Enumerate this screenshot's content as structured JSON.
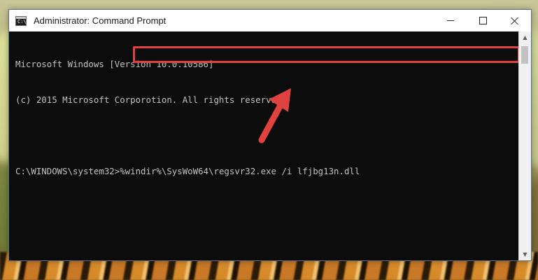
{
  "window": {
    "title": "Administrator: Command Prompt",
    "icon_label": "C:\\_"
  },
  "controls": {
    "minimize": "minimize",
    "maximize": "maximize",
    "close": "close"
  },
  "console": {
    "lines": [
      "Microsoft Windows [Version 10.0.10586]",
      "(c) 2015 Microsoft Corporotion. All rights reserved."
    ],
    "prompt": "C:\\WINDOWS\\system32>",
    "command": "%windir%\\SysWoW64\\regsvr32.exe /i lfjbg13n.dll"
  },
  "colors": {
    "highlight": "#e0433f",
    "console_bg": "#0c0c0c",
    "console_text": "#c0c0c0"
  },
  "icons": {
    "app": "cmd-icon",
    "annotation": "red-arrow-icon"
  },
  "scrollbar": {
    "up": "▲",
    "down": "▼"
  }
}
